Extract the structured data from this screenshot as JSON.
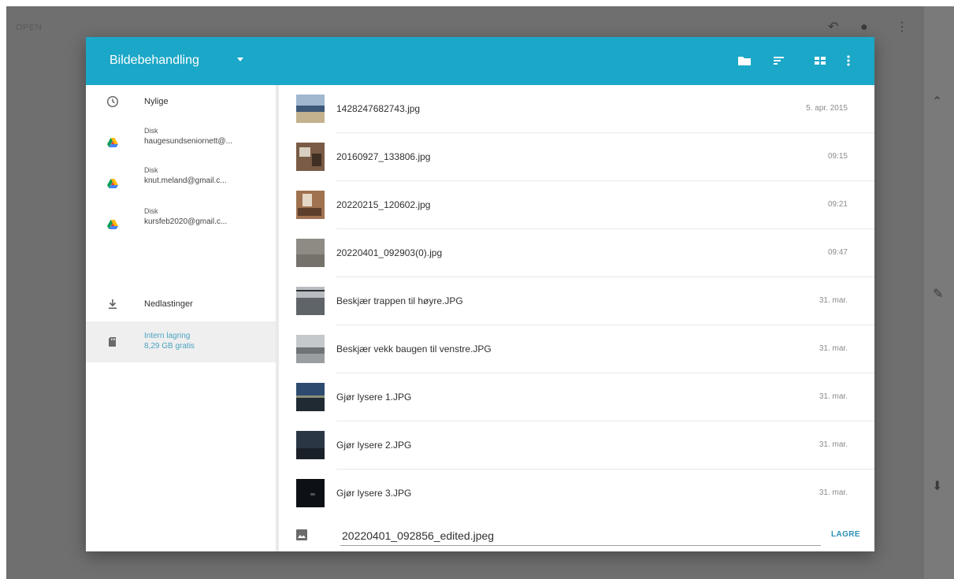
{
  "background": {
    "open_label": "OPEN"
  },
  "dialog": {
    "title": "Bildebehandling"
  },
  "sidebar": {
    "items": [
      {
        "label": "Nylige",
        "icon": "clock-icon"
      },
      {
        "label": "Disk",
        "sub": "haugesundseniornett@...",
        "icon": "google-drive-icon"
      },
      {
        "label": "Disk",
        "sub": "knut.meland@gmail.c...",
        "icon": "google-drive-icon"
      },
      {
        "label": "Disk",
        "sub": "kursfeb2020@gmail.c...",
        "icon": "google-drive-icon"
      },
      {
        "label": "Nedlastinger",
        "icon": "download-icon"
      },
      {
        "label": "Intern lagring",
        "sub": "8,29 GB gratis",
        "icon": "sd-card-icon"
      }
    ]
  },
  "files": [
    {
      "name": "1428247682743.jpg",
      "date": "5. apr. 2015"
    },
    {
      "name": "20160927_133806.jpg",
      "date": "09:15"
    },
    {
      "name": "20220215_120602.jpg",
      "date": "09:21"
    },
    {
      "name": "20220401_092903(0).jpg",
      "date": "09:47"
    },
    {
      "name": "Beskjær trappen til høyre.JPG",
      "date": "31. mar."
    },
    {
      "name": "Beskjær vekk baugen til venstre.JPG",
      "date": "31. mar."
    },
    {
      "name": "Gjør lysere 1.JPG",
      "date": "31. mar."
    },
    {
      "name": "Gjør lysere 2.JPG",
      "date": "31. mar."
    },
    {
      "name": "Gjør lysere 3.JPG",
      "date": "31. mar."
    }
  ],
  "save": {
    "filename": "20220401_092856_edited.jpeg",
    "button_label": "LAGRE"
  },
  "colors": {
    "toolbar": "#1ba7c7",
    "accent": "#2a8fb3"
  }
}
